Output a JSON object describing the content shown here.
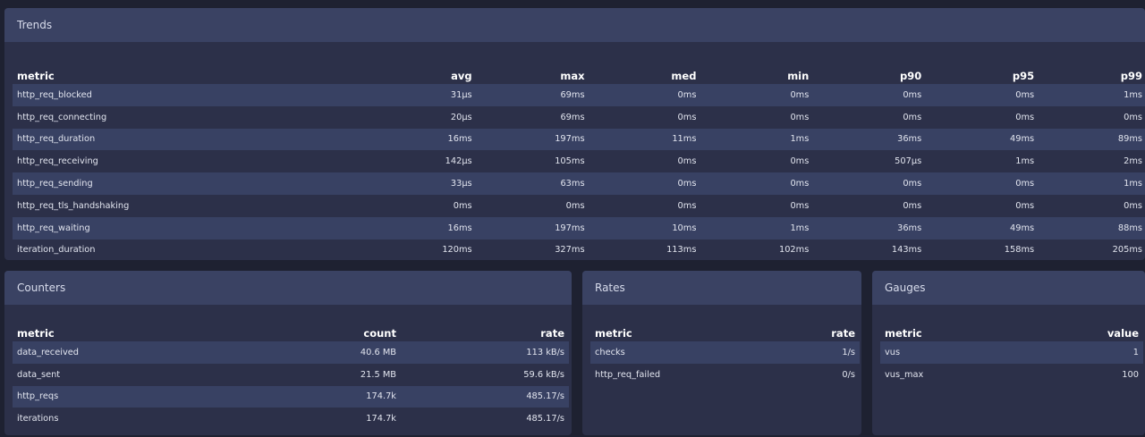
{
  "trends": {
    "title": "Trends",
    "columns": [
      "metric",
      "avg",
      "max",
      "med",
      "min",
      "p90",
      "p95",
      "p99"
    ],
    "rows": [
      [
        "http_req_blocked",
        "31µs",
        "69ms",
        "0ms",
        "0ms",
        "0ms",
        "0ms",
        "1ms"
      ],
      [
        "http_req_connecting",
        "20µs",
        "69ms",
        "0ms",
        "0ms",
        "0ms",
        "0ms",
        "0ms"
      ],
      [
        "http_req_duration",
        "16ms",
        "197ms",
        "11ms",
        "1ms",
        "36ms",
        "49ms",
        "89ms"
      ],
      [
        "http_req_receiving",
        "142µs",
        "105ms",
        "0ms",
        "0ms",
        "507µs",
        "1ms",
        "2ms"
      ],
      [
        "http_req_sending",
        "33µs",
        "63ms",
        "0ms",
        "0ms",
        "0ms",
        "0ms",
        "1ms"
      ],
      [
        "http_req_tls_handshaking",
        "0ms",
        "0ms",
        "0ms",
        "0ms",
        "0ms",
        "0ms",
        "0ms"
      ],
      [
        "http_req_waiting",
        "16ms",
        "197ms",
        "10ms",
        "1ms",
        "36ms",
        "49ms",
        "88ms"
      ],
      [
        "iteration_duration",
        "120ms",
        "327ms",
        "113ms",
        "102ms",
        "143ms",
        "158ms",
        "205ms"
      ]
    ]
  },
  "counters": {
    "title": "Counters",
    "columns": [
      "metric",
      "count",
      "rate"
    ],
    "rows": [
      [
        "data_received",
        "40.6 MB",
        "113 kB/s"
      ],
      [
        "data_sent",
        "21.5 MB",
        "59.6 kB/s"
      ],
      [
        "http_reqs",
        "174.7k",
        "485.17/s"
      ],
      [
        "iterations",
        "174.7k",
        "485.17/s"
      ]
    ]
  },
  "rates": {
    "title": "Rates",
    "columns": [
      "metric",
      "rate"
    ],
    "rows": [
      [
        "checks",
        "1/s"
      ],
      [
        "http_req_failed",
        "0/s"
      ]
    ]
  },
  "gauges": {
    "title": "Gauges",
    "columns": [
      "metric",
      "value"
    ],
    "rows": [
      [
        "vus",
        "1"
      ],
      [
        "vus_max",
        "100"
      ]
    ]
  },
  "colors": {
    "background": "#1e2131",
    "panel": "#2c3049",
    "panel_header": "#3a4263",
    "row_alt": "#384163"
  }
}
